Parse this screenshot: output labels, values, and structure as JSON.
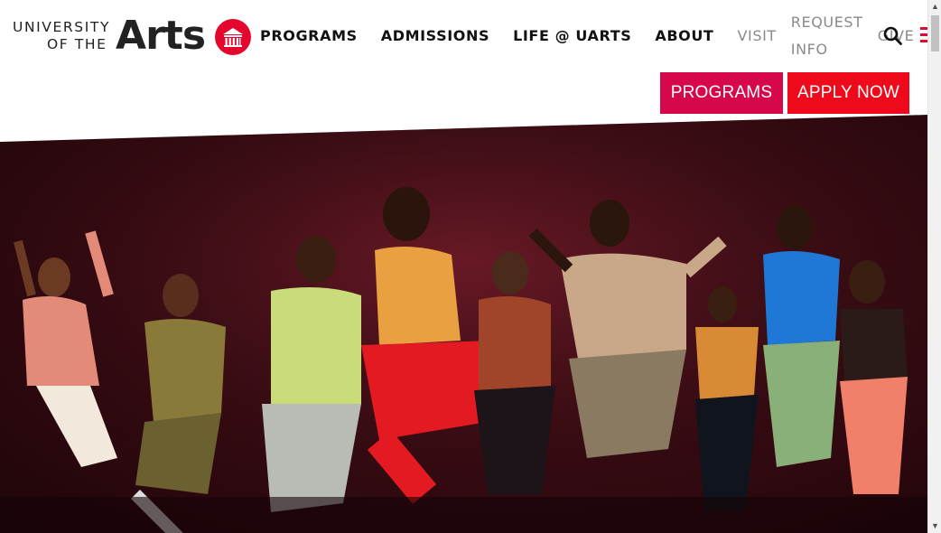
{
  "logo": {
    "line1": "UNIVERSITY",
    "line2": "OF THE",
    "big": "Arts"
  },
  "nav": {
    "items": [
      {
        "label": "PROGRAMS"
      },
      {
        "label": "ADMISSIONS"
      },
      {
        "label": "LIFE @ UARTS"
      },
      {
        "label": "ABOUT"
      }
    ],
    "secondary": [
      {
        "label": "VISIT"
      },
      {
        "label": "REQUEST INFO"
      },
      {
        "label": "GIVE"
      }
    ],
    "search_icon": "search-icon",
    "menu_icon": "hamburger-menu-icon"
  },
  "cta": {
    "programs": "PROGRAMS",
    "apply": "APPLY NOW"
  },
  "hero": {
    "image": "dancers-jumping-photo"
  },
  "colors": {
    "brand_red": "#e5062d",
    "programs_btn": "#d6084b",
    "apply_btn": "#ee0a1b"
  }
}
